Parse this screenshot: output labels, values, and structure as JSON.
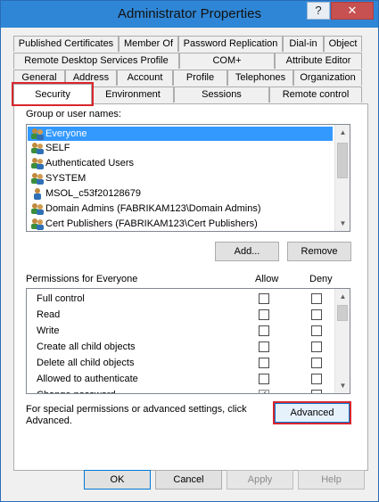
{
  "window": {
    "title": "Administrator Properties",
    "help_label": "?",
    "close_label": "✕"
  },
  "tabs": {
    "row1": [
      "Published Certificates",
      "Member Of",
      "Password Replication",
      "Dial-in",
      "Object"
    ],
    "row2": [
      "Remote Desktop Services Profile",
      "COM+",
      "Attribute Editor"
    ],
    "row3": [
      "General",
      "Address",
      "Account",
      "Profile",
      "Telephones",
      "Organization"
    ],
    "row4": [
      "Security",
      "Environment",
      "Sessions",
      "Remote control"
    ]
  },
  "security": {
    "group_label": "Group or user names:",
    "users": [
      {
        "name": "Everyone",
        "icon": "group-icon",
        "selected": true
      },
      {
        "name": "SELF",
        "icon": "group-icon",
        "selected": false
      },
      {
        "name": "Authenticated Users",
        "icon": "group-icon",
        "selected": false
      },
      {
        "name": "SYSTEM",
        "icon": "group-icon",
        "selected": false
      },
      {
        "name": "MSOL_c53f20128679",
        "icon": "user-icon",
        "selected": false
      },
      {
        "name": "Domain Admins (FABRIKAM123\\Domain Admins)",
        "icon": "group-icon",
        "selected": false
      },
      {
        "name": "Cert Publishers (FABRIKAM123\\Cert Publishers)",
        "icon": "group-icon",
        "selected": false
      }
    ],
    "add_label": "Add...",
    "remove_label": "Remove",
    "permissions_label": "Permissions for Everyone",
    "allow_label": "Allow",
    "deny_label": "Deny",
    "permissions": [
      {
        "name": "Full control",
        "allow": false,
        "deny": false
      },
      {
        "name": "Read",
        "allow": false,
        "deny": false
      },
      {
        "name": "Write",
        "allow": false,
        "deny": false
      },
      {
        "name": "Create all child objects",
        "allow": false,
        "deny": false
      },
      {
        "name": "Delete all child objects",
        "allow": false,
        "deny": false
      },
      {
        "name": "Allowed to authenticate",
        "allow": false,
        "deny": false
      },
      {
        "name": "Change password",
        "allow": true,
        "deny": false
      }
    ],
    "advanced_text": "For special permissions or advanced settings, click Advanced.",
    "advanced_label": "Advanced"
  },
  "footer": {
    "ok_label": "OK",
    "cancel_label": "Cancel",
    "apply_label": "Apply",
    "help_label": "Help"
  },
  "colors": {
    "titlebar": "#2f86d6",
    "highlight": "#d9262c",
    "selection": "#3399ff"
  }
}
